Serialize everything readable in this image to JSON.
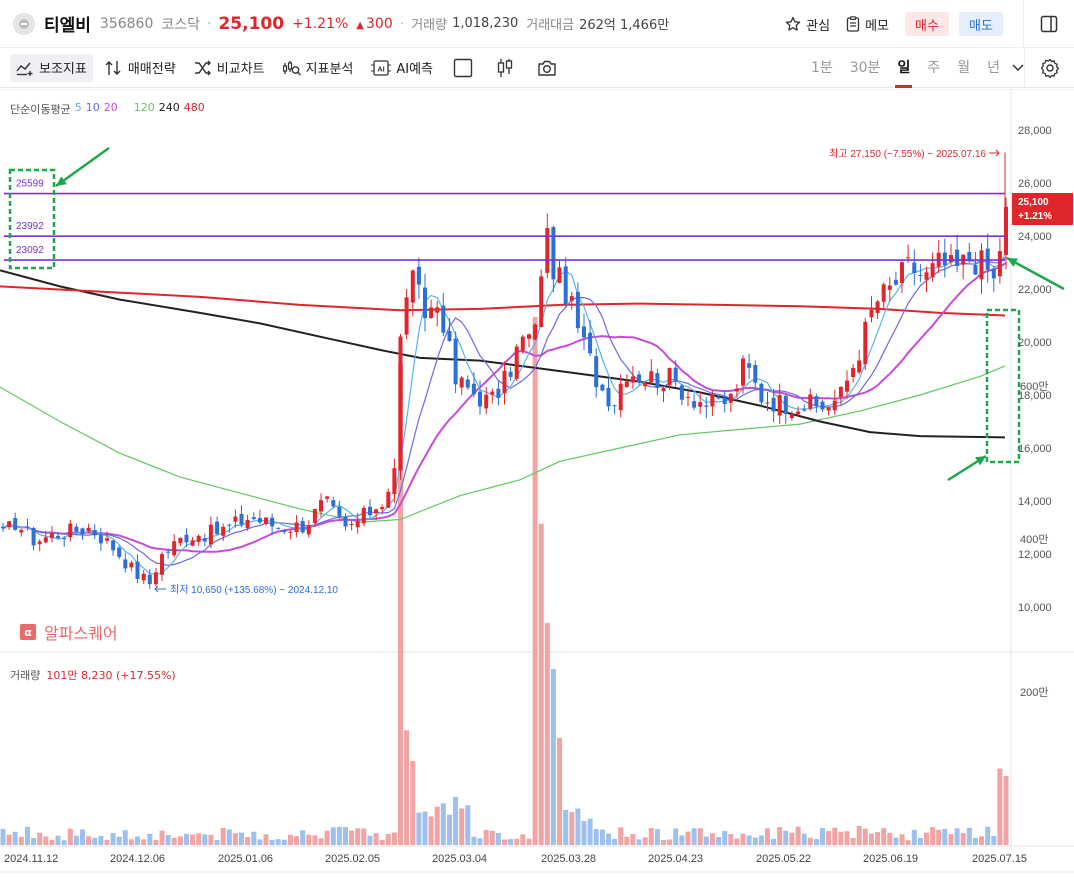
{
  "header": {
    "stock_name": "티엘비",
    "stock_code": "356860",
    "market": "코스닥",
    "separator": "·",
    "price": "25,100",
    "change_pct": "+1.21%",
    "change_arrow": "▲",
    "change_amount": "300",
    "volume_label": "거래량",
    "volume_value": "1,018,230",
    "amount_label": "거래대금",
    "amount_value": "262억 1,466만",
    "watch_label": "관심",
    "memo_label": "메모",
    "buy_label": "매수",
    "sell_label": "매도"
  },
  "toolbar": {
    "indicators_label": "보조지표",
    "strategy_label": "매매전략",
    "compare_label": "비교차트",
    "analysis_label": "지표분석",
    "ai_label": "AI예측",
    "ai_badge": "AI",
    "periods": [
      "1분",
      "30분",
      "일",
      "주",
      "월",
      "년"
    ],
    "selected_period": "일"
  },
  "legend": {
    "title": "단순이동평균",
    "ma": [
      {
        "label": "5",
        "color": "#5ab4ea"
      },
      {
        "label": "10",
        "color": "#6b6be8"
      },
      {
        "label": "20",
        "color": "#c84bd8"
      },
      {
        "label": "120",
        "color": "#61c961"
      },
      {
        "label": "240",
        "color": "#222222"
      },
      {
        "label": "480",
        "color": "#e0262d"
      }
    ]
  },
  "watermark": {
    "icon": "α",
    "text": "알파스퀘어"
  },
  "volume_legend": {
    "label": "거래량",
    "value": "101만 8,230 (+17.55%)"
  },
  "colors": {
    "up": "#e0262d",
    "down": "#2b6fd8",
    "vol_up": "#f2a3a3",
    "vol_down": "#9ec0ef",
    "hline": "#7b2ee0",
    "annotation": "#1aa84a"
  },
  "chart_data": {
    "type": "candlestick",
    "title": "",
    "price_axis": {
      "min": 8000,
      "max": 30000,
      "ticks": [
        10000,
        12000,
        14000,
        16000,
        18000,
        20000,
        22000,
        24000,
        26000,
        28000
      ],
      "tick_labels": [
        "10,000",
        "12,000",
        "14,000",
        "16,000",
        "18,000",
        "20,000",
        "22,000",
        "24,000",
        "26,000",
        "28,000"
      ]
    },
    "volume_axis": {
      "max": 7000000,
      "tick_labels": [
        "200만",
        "400만",
        "600만"
      ],
      "ticks": [
        2000000,
        4000000,
        6000000
      ]
    },
    "date_labels": [
      "2024.11.12",
      "2024.12.06",
      "2025.01.06",
      "2025.02.05",
      "2025.03.04",
      "2025.03.28",
      "2025.04.23",
      "2025.05.22",
      "2025.06.19",
      "2025.07.15"
    ],
    "last_price": {
      "value": "25,100",
      "pct": "+1.21%"
    },
    "high_annotation": "최고 27,150 (−7.55%) − 2025.07.16",
    "low_annotation": "최저 10,650 (+135.68%) − 2024.12.10",
    "horizontal_lines": [
      {
        "value": 25599,
        "label": "25599"
      },
      {
        "value": 23992,
        "label": "23992"
      },
      {
        "value": 23092,
        "label": "23092"
      }
    ],
    "ma_lines": [
      {
        "name": "120",
        "color": "#61c961",
        "points": [
          [
            0,
            18300
          ],
          [
            60,
            17000
          ],
          [
            120,
            15800
          ],
          [
            180,
            14900
          ],
          [
            240,
            14300
          ],
          [
            300,
            13700
          ],
          [
            360,
            13200
          ],
          [
            400,
            13300
          ],
          [
            460,
            14200
          ],
          [
            520,
            14800
          ],
          [
            560,
            15500
          ],
          [
            620,
            16000
          ],
          [
            680,
            16500
          ],
          [
            740,
            16700
          ],
          [
            800,
            16900
          ],
          [
            860,
            17400
          ],
          [
            920,
            18000
          ],
          [
            980,
            18700
          ],
          [
            1005,
            19100
          ]
        ]
      },
      {
        "name": "240",
        "color": "#222222",
        "points": [
          [
            0,
            22700
          ],
          [
            60,
            22100
          ],
          [
            120,
            21600
          ],
          [
            200,
            21100
          ],
          [
            260,
            20700
          ],
          [
            320,
            20200
          ],
          [
            380,
            19700
          ],
          [
            420,
            19400
          ],
          [
            480,
            19300
          ],
          [
            560,
            18900
          ],
          [
            640,
            18500
          ],
          [
            700,
            18100
          ],
          [
            760,
            17600
          ],
          [
            820,
            17000
          ],
          [
            870,
            16600
          ],
          [
            920,
            16450
          ],
          [
            1005,
            16400
          ]
        ]
      },
      {
        "name": "480",
        "color": "#e0262d",
        "points": [
          [
            0,
            22100
          ],
          [
            100,
            21900
          ],
          [
            200,
            21700
          ],
          [
            300,
            21400
          ],
          [
            400,
            21200
          ],
          [
            480,
            21250
          ],
          [
            560,
            21400
          ],
          [
            640,
            21450
          ],
          [
            720,
            21400
          ],
          [
            800,
            21350
          ],
          [
            880,
            21250
          ],
          [
            940,
            21100
          ],
          [
            1005,
            21000
          ]
        ]
      }
    ]
  }
}
